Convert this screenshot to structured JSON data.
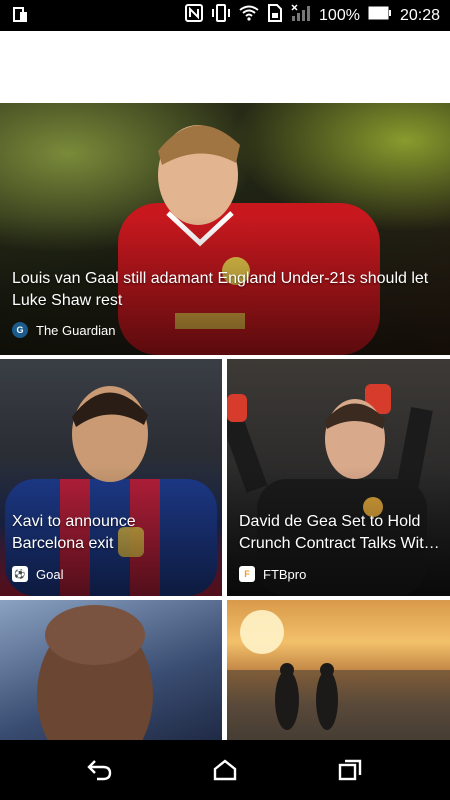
{
  "status_bar": {
    "battery_percent": "100%",
    "time": "20:28",
    "icons": [
      "screen-icon",
      "nfc-icon",
      "vibrate-icon",
      "wifi-icon",
      "sim-icon",
      "signal-icon",
      "battery-icon"
    ]
  },
  "feed": {
    "hero": {
      "title": "Louis van Gaal still adamant England Under-21s should let Luke Shaw rest",
      "source": "The Guardian"
    },
    "cards": [
      {
        "title": "Xavi to announce Barcelona exit",
        "source": "Goal"
      },
      {
        "title": "David de Gea Set to Hold Crunch Contract Talks Wit…",
        "source": "FTBpro"
      }
    ]
  },
  "nav_bar": {
    "buttons": [
      "back-icon",
      "home-icon",
      "recents-icon"
    ]
  },
  "colors": {
    "status_bar_bg": "#000000",
    "nav_bar_bg": "#000000",
    "guardian_blue": "#1a5a8c",
    "ftbpro_orange": "#f29a1c"
  }
}
